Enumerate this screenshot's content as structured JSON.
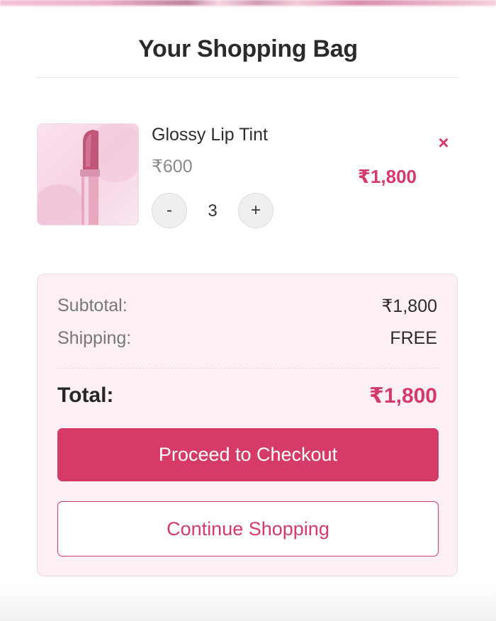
{
  "page": {
    "title": "Your Shopping Bag"
  },
  "cart": {
    "items": [
      {
        "name": "Glossy Lip Tint",
        "unit_price": "₹600",
        "quantity": "3",
        "line_total": "₹1,800",
        "image_icon": "lipstick-image",
        "minus_label": "-",
        "plus_label": "+",
        "remove_label": "×"
      }
    ]
  },
  "summary": {
    "subtotal_label": "Subtotal:",
    "subtotal_value": "₹1,800",
    "shipping_label": "Shipping:",
    "shipping_value": "FREE",
    "total_label": "Total:",
    "total_value": "₹1,800",
    "checkout_label": "Proceed to Checkout",
    "continue_label": "Continue Shopping"
  },
  "colors": {
    "accent": "#d63a6a",
    "summary_bg": "#fcf0f4"
  }
}
